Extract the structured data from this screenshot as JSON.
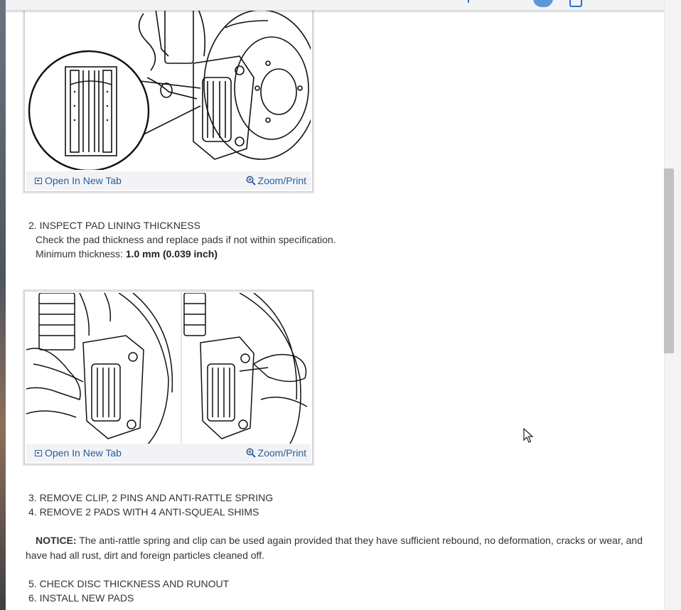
{
  "figures": [
    {
      "open_label": "Open In New Tab",
      "zoom_label": "Zoom/Print"
    },
    {
      "open_label": "Open In New Tab",
      "zoom_label": "Zoom/Print"
    }
  ],
  "steps": {
    "s2": "2. INSPECT PAD LINING THICKNESS",
    "s2_desc": "Check the pad thickness and replace pads if not within specification.",
    "s2_min_label": "Minimum thickness:",
    "s2_min_value": "1.0 mm (0.039 inch)",
    "s3": "3. REMOVE CLIP, 2 PINS AND ANTI-RATTLE SPRING",
    "s4": "4. REMOVE 2 PADS WITH 4 ANTI-SQUEAL SHIMS",
    "notice_label": "NOTICE:",
    "notice_text": "The anti-rattle spring and clip can be used again provided that they have sufficient rebound, no deformation, cracks or wear, and have had all rust, dirt and foreign particles cleaned off.",
    "s5": "5. CHECK DISC THICKNESS AND RUNOUT",
    "s6": "6. INSTALL NEW PADS"
  },
  "colors": {
    "link": "#2b5e95",
    "text": "#333333",
    "accent": "#5e97d8"
  }
}
